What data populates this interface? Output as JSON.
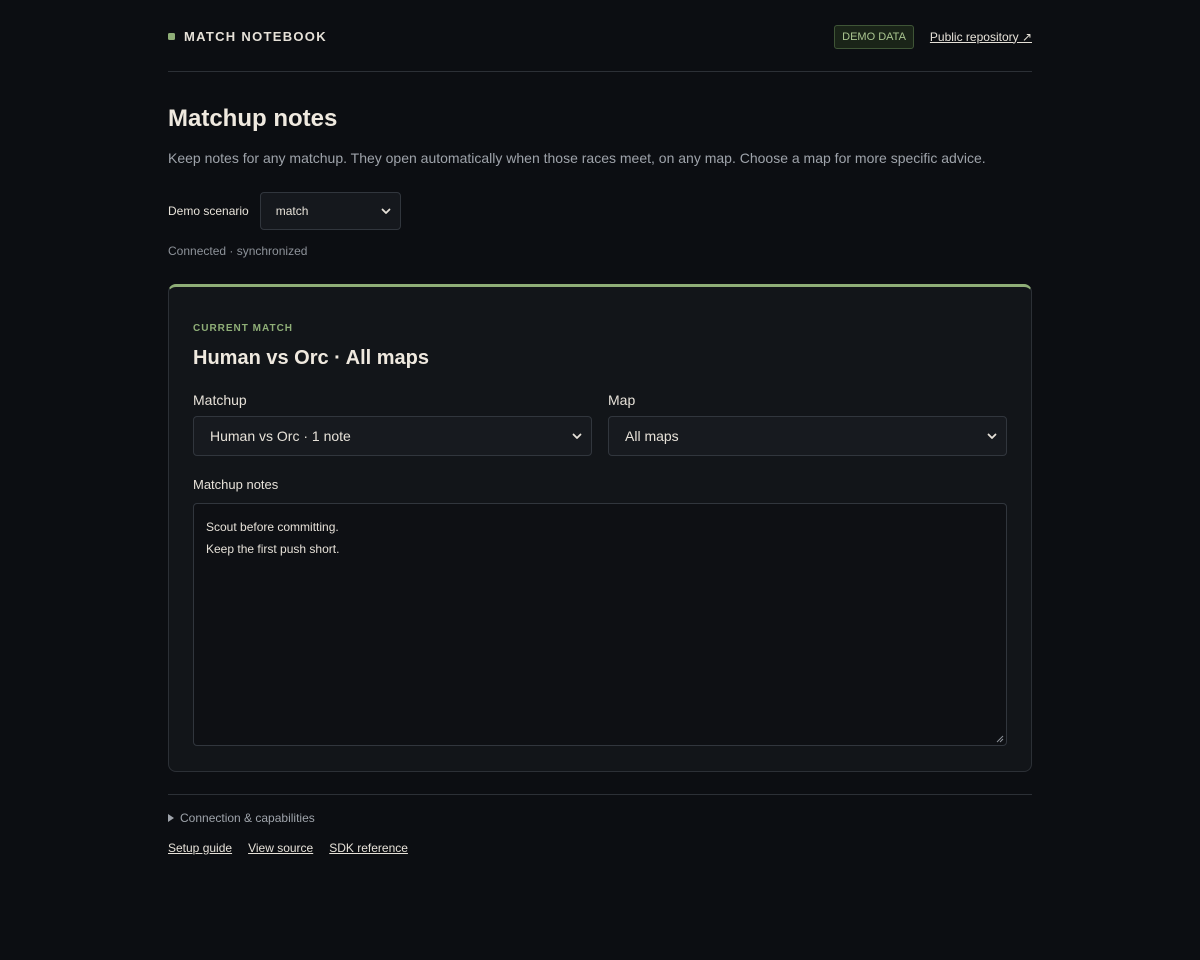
{
  "header": {
    "brand": "MATCH NOTEBOOK",
    "badge": "DEMO DATA",
    "repo_link": "Public repository ↗"
  },
  "page": {
    "title": "Matchup notes",
    "description": "Keep notes for any matchup. They open automatically when those races meet, on any map. Choose a map for more specific advice.",
    "scenario_label": "Demo scenario",
    "scenario_value": "match",
    "status": "Connected · synchronized"
  },
  "card": {
    "eyebrow": "CURRENT MATCH",
    "title": "Human vs Orc · All maps",
    "matchup_label": "Matchup",
    "matchup_value": "Human vs Orc · 1 note",
    "map_label": "Map",
    "map_value": "All maps",
    "notes_label": "Matchup notes",
    "notes_lines": [
      "Scout before committing.",
      "Keep the first push short."
    ]
  },
  "footer": {
    "details_label": "Connection & capabilities",
    "links": [
      "Setup guide",
      "View source",
      "SDK reference"
    ]
  },
  "colors": {
    "background": "#0c0e12",
    "accent": "#8fae77",
    "text": "#e6e1d8",
    "muted": "#9ea3aa"
  },
  "icons": {
    "brand": "square-dot-icon",
    "select": "chevron-down-icon",
    "details": "disclosure-triangle-icon",
    "textarea": "resize-grip-icon"
  }
}
